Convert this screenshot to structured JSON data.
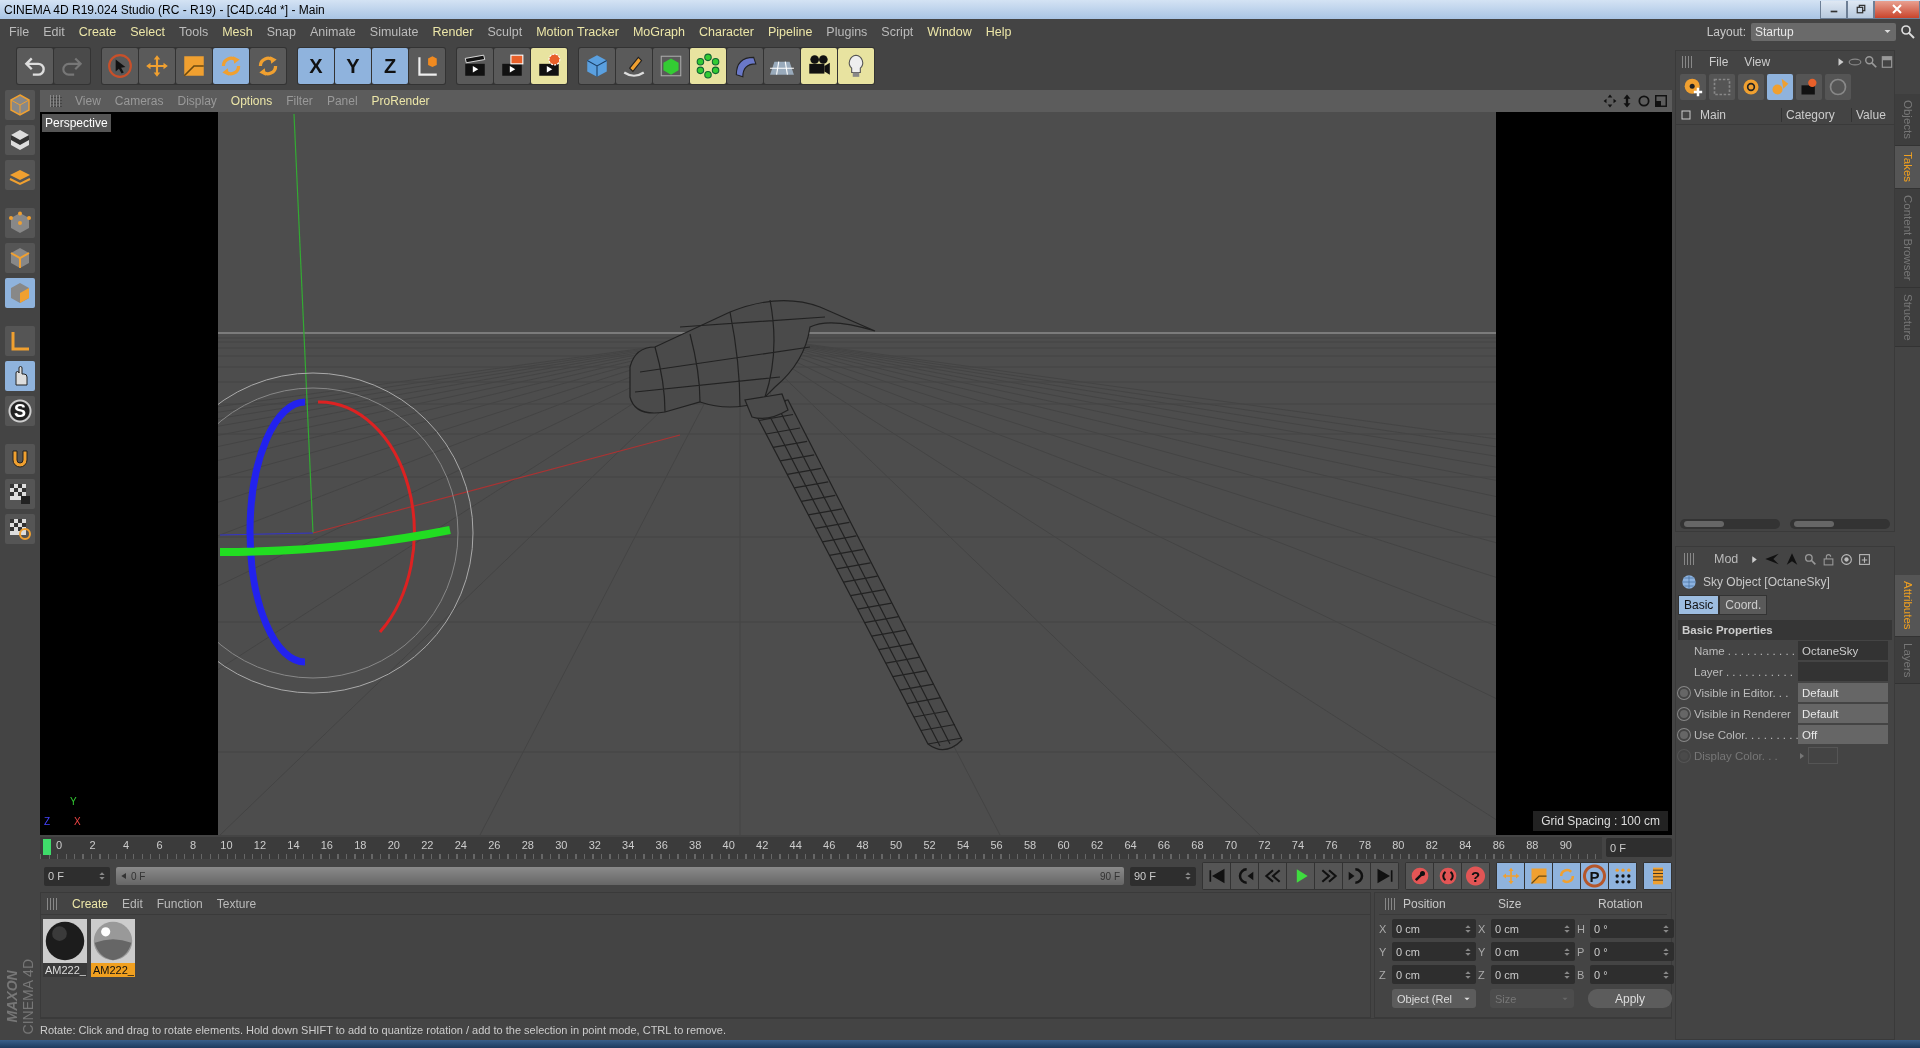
{
  "window": {
    "title": "CINEMA 4D R19.024 Studio (RC - R19) - [C4D.c4d *] - Main"
  },
  "menu": [
    {
      "label": "File",
      "highlighted": false
    },
    {
      "label": "Edit",
      "highlighted": false
    },
    {
      "label": "Create",
      "highlighted": true
    },
    {
      "label": "Select",
      "highlighted": true
    },
    {
      "label": "Tools",
      "highlighted": false
    },
    {
      "label": "Mesh",
      "highlighted": true
    },
    {
      "label": "Snap",
      "highlighted": false
    },
    {
      "label": "Animate",
      "highlighted": false
    },
    {
      "label": "Simulate",
      "highlighted": false
    },
    {
      "label": "Render",
      "highlighted": true
    },
    {
      "label": "Sculpt",
      "highlighted": false
    },
    {
      "label": "Motion Tracker",
      "highlighted": true
    },
    {
      "label": "MoGraph",
      "highlighted": true
    },
    {
      "label": "Character",
      "highlighted": true
    },
    {
      "label": "Pipeline",
      "highlighted": true
    },
    {
      "label": "Plugins",
      "highlighted": false
    },
    {
      "label": "Script",
      "highlighted": false
    },
    {
      "label": "Window",
      "highlighted": true
    },
    {
      "label": "Help",
      "highlighted": true
    }
  ],
  "layout": {
    "label": "Layout:",
    "value": "Startup"
  },
  "toolbar": [
    {
      "items": [
        {
          "kind": "undo",
          "selected": false,
          "disabled": false
        },
        {
          "kind": "redo",
          "selected": false,
          "disabled": true
        }
      ]
    },
    {
      "items": [
        {
          "kind": "select",
          "selected": false,
          "disabled": false
        },
        {
          "kind": "move",
          "selected": false,
          "disabled": false
        },
        {
          "kind": "scale",
          "selected": false,
          "disabled": false
        },
        {
          "kind": "rotate",
          "selected": true,
          "disabled": false
        },
        {
          "kind": "rotate",
          "selected": false,
          "disabled": false
        }
      ]
    },
    {
      "items": [
        {
          "kind": "axis",
          "label": "X",
          "selected": true,
          "disabled": false
        },
        {
          "kind": "axis",
          "label": "Y",
          "selected": true,
          "disabled": false
        },
        {
          "kind": "axis",
          "label": "Z",
          "selected": true,
          "disabled": false
        },
        {
          "kind": "coord",
          "selected": false,
          "disabled": false
        }
      ]
    },
    {
      "items": [
        {
          "kind": "render",
          "selected": false,
          "disabled": false
        },
        {
          "kind": "render-view",
          "selected": false,
          "disabled": false
        },
        {
          "kind": "render-settings",
          "selected": true,
          "disabled": false
        }
      ]
    },
    {
      "items": [
        {
          "kind": "cube",
          "selected": false,
          "disabled": false
        },
        {
          "kind": "pen",
          "selected": false,
          "disabled": false
        },
        {
          "kind": "subdiv",
          "selected": false,
          "disabled": false
        },
        {
          "kind": "cloner",
          "selected": true,
          "disabled": false
        },
        {
          "kind": "deformer",
          "selected": false,
          "disabled": false
        },
        {
          "kind": "floor",
          "selected": false,
          "disabled": false
        },
        {
          "kind": "camera",
          "selected": true,
          "disabled": false
        },
        {
          "kind": "light",
          "selected": true,
          "disabled": false
        }
      ]
    }
  ],
  "left_tools": [
    {
      "kind": "model",
      "selected": false
    },
    {
      "kind": "texture",
      "selected": false
    },
    {
      "kind": "workplane",
      "selected": false
    },
    {
      "kind": "points",
      "selected": false
    },
    {
      "kind": "edges",
      "selected": false
    },
    {
      "kind": "polygons",
      "selected": true
    },
    {
      "kind": "axis-l",
      "selected": false
    },
    {
      "kind": "tweak",
      "selected": true
    },
    {
      "kind": "letter",
      "label": "S",
      "selected": false
    },
    {
      "kind": "magnet",
      "selected": false
    },
    {
      "kind": "checker-lock",
      "selected": false
    },
    {
      "kind": "checker-cycle",
      "selected": false
    }
  ],
  "brand": {
    "line_1": "MAXON",
    "line_2": "CINEMA 4D"
  },
  "viewport": {
    "menu": [
      {
        "label": "View",
        "highlighted": false
      },
      {
        "label": "Cameras",
        "highlighted": false
      },
      {
        "label": "Display",
        "highlighted": false
      },
      {
        "label": "Options",
        "highlighted": true
      },
      {
        "label": "Filter",
        "highlighted": false
      },
      {
        "label": "Panel",
        "highlighted": false
      },
      {
        "label": "ProRender",
        "highlighted": true
      }
    ],
    "camera": "Perspective",
    "grid_spacing": "Grid Spacing : 100 cm",
    "axes": [
      "Y",
      "Z",
      "X"
    ]
  },
  "timeline": {
    "range": {
      "level": 1,
      "start": "0 F",
      "end": "90 F"
    },
    "ticks": [
      "0",
      "2",
      "4",
      "6",
      "8",
      "10",
      "12",
      "14",
      "16",
      "18",
      "20",
      "22",
      "24",
      "26",
      "28",
      "30",
      "32",
      "34",
      "36",
      "38",
      "40",
      "42",
      "44",
      "46",
      "48",
      "50",
      "52",
      "54",
      "56",
      "58",
      "60",
      "62",
      "64",
      "66",
      "68",
      "70",
      "72",
      "74",
      "76",
      "78",
      "80",
      "82",
      "84",
      "86",
      "88",
      "90"
    ],
    "level": 0,
    "current": "0 F",
    "start": "0 F",
    "end": "90 F"
  },
  "transport": [
    {
      "items": [
        {
          "kind": "first"
        },
        {
          "kind": "prev-key"
        },
        {
          "kind": "prev"
        },
        {
          "kind": "play"
        },
        {
          "kind": "next"
        },
        {
          "kind": "next-key"
        },
        {
          "kind": "last"
        }
      ]
    },
    {
      "items": [
        {
          "kind": "record"
        },
        {
          "kind": "autokey"
        },
        {
          "kind": "help",
          "label": "?"
        }
      ]
    },
    {
      "items": [
        {
          "kind": "key-move"
        },
        {
          "kind": "key-scale"
        },
        {
          "kind": "key-rotate"
        },
        {
          "kind": "key-param",
          "label": "P"
        },
        {
          "kind": "dots"
        }
      ]
    },
    {
      "items": [
        {
          "kind": "film"
        }
      ]
    }
  ],
  "materials": {
    "menu": [
      {
        "label": "Create",
        "highlighted": true
      },
      {
        "label": "Edit",
        "highlighted": false
      },
      {
        "label": "Function",
        "highlighted": false
      },
      {
        "label": "Texture",
        "highlighted": false
      }
    ],
    "items": [
      {
        "label": "AM222_",
        "kind": "matte",
        "selected": false
      },
      {
        "label": "AM222_",
        "kind": "chrome",
        "selected": true
      }
    ]
  },
  "coordinates": {
    "headers": [
      "Position",
      "Size",
      "Rotation"
    ],
    "rows": [
      {
        "axes": [
          "X",
          "X",
          "H"
        ],
        "values": [
          "0 cm",
          "0 cm",
          "0 °"
        ]
      },
      {
        "axes": [
          "Y",
          "Y",
          "P"
        ],
        "values": [
          "0 cm",
          "0 cm",
          "0 °"
        ]
      },
      {
        "axes": [
          "Z",
          "Z",
          "B"
        ],
        "values": [
          "0 cm",
          "0 cm",
          "0 °"
        ]
      }
    ],
    "mode": {
      "label": "Object (Rel",
      "disabled": false
    },
    "size_mode": {
      "label": "Size",
      "disabled": true
    },
    "apply": "Apply"
  },
  "status_bar": "Rotate: Click and drag to rotate elements. Hold down SHIFT to add to quantize rotation / add to the selection in point mode, CTRL to remove.",
  "objects": {
    "menu": [
      "File",
      "View"
    ],
    "columns": [
      "Main",
      "Category",
      "Value"
    ]
  },
  "attributes": {
    "menu": "Mod",
    "object": "Sky Object [OctaneSky]",
    "tabs": [
      {
        "label": "Basic",
        "selected": true
      },
      {
        "label": "Coord.",
        "selected": false
      }
    ],
    "section": "Basic Properties",
    "fields": [
      {
        "kind": "text",
        "label": "Name . . . . . . . . . . .",
        "value": "OctaneSky",
        "disabled": false
      },
      {
        "kind": "text",
        "label": "Layer . . . . . . . . . . .",
        "disabled": false
      },
      {
        "kind": "choice",
        "label": "Visible in Editor. . .",
        "value": "Default",
        "disabled": false,
        "keyframed": false
      },
      {
        "kind": "choice",
        "label": "Visible in Renderer",
        "value": "Default",
        "disabled": false,
        "keyframed": false
      },
      {
        "kind": "choice",
        "label": "Use Color. . . . . . . . .",
        "value": "Off",
        "disabled": false,
        "keyframed": false
      },
      {
        "kind": "color",
        "label": "Display Color. . .",
        "disabled": true,
        "keyframed": false
      }
    ]
  },
  "side_tabs": {
    "top": [
      {
        "label": "Objects",
        "selected": false
      },
      {
        "label": "Takes",
        "selected": true
      },
      {
        "label": "Content Browser",
        "selected": false
      },
      {
        "label": "Structure",
        "selected": false
      }
    ],
    "bottom": [
      {
        "label": "Attributes",
        "selected": true
      },
      {
        "label": "Layers",
        "selected": false
      }
    ]
  }
}
